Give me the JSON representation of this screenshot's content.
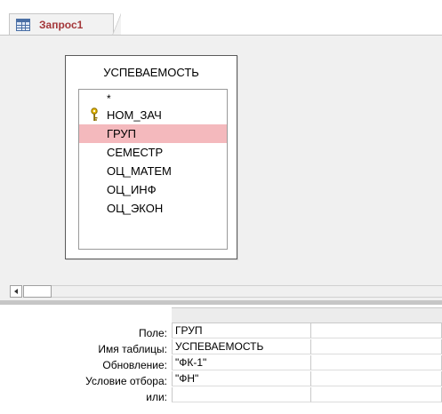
{
  "tab": {
    "label": "Запрос1",
    "icon": "query-table-icon"
  },
  "table": {
    "name": "УСПЕВАЕМОСТЬ",
    "fields": [
      {
        "label": "*",
        "key": false,
        "selected": false
      },
      {
        "label": "НОМ_ЗАЧ",
        "key": true,
        "selected": false
      },
      {
        "label": "ГРУП",
        "key": false,
        "selected": true
      },
      {
        "label": "СЕМЕСТР",
        "key": false,
        "selected": false
      },
      {
        "label": "ОЦ_МАТЕМ",
        "key": false,
        "selected": false
      },
      {
        "label": "ОЦ_ИНФ",
        "key": false,
        "selected": false
      },
      {
        "label": "ОЦ_ЭКОН",
        "key": false,
        "selected": false
      }
    ]
  },
  "grid": {
    "row_labels": [
      "Поле:",
      "Имя таблицы:",
      "Обновление:",
      "Условие отбора:",
      "или:"
    ],
    "columns": [
      {
        "field": "ГРУП",
        "table": "УСПЕВАЕМОСТЬ",
        "update": "\"ФК-1\"",
        "criteria": "\"ФН\"",
        "or": ""
      },
      {
        "field": "",
        "table": "",
        "update": "",
        "criteria": "",
        "or": ""
      }
    ]
  },
  "colors": {
    "selected_row": "#f4b9bd",
    "tab_label": "#a4373a",
    "design_bg": "#f0f0f0"
  }
}
